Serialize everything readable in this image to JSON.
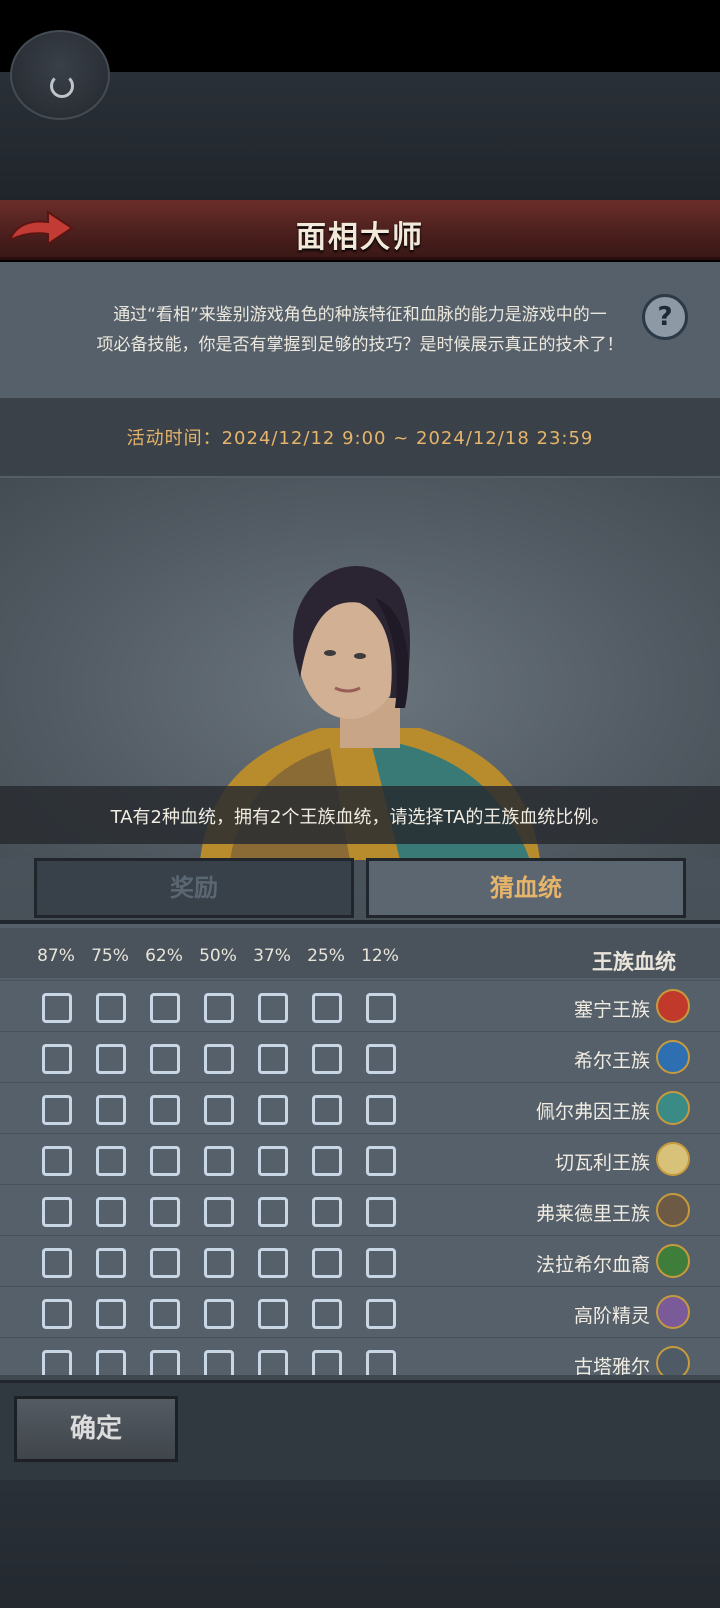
{
  "header": {
    "title": "面相大师"
  },
  "intro": {
    "line1": "通过“看相”来鉴别游戏角色的种族特征和血脉的能力是游戏中的一",
    "line2": "项必备技能，你是否有掌握到足够的技巧？是时候展示真正的技术了！"
  },
  "event": {
    "time_text": "活动时间：2024/12/12 9:00 ~ 2024/12/18 23:59"
  },
  "question": {
    "text": "TA有2种血统，拥有2个王族血统，请选择TA的王族血统比例。"
  },
  "tabs": [
    {
      "label": "猜血统",
      "active": true
    },
    {
      "label": "奖励",
      "active": false
    }
  ],
  "grid": {
    "column_title": "王族血统",
    "percentages": [
      "12%",
      "25%",
      "37%",
      "50%",
      "62%",
      "75%",
      "87%"
    ],
    "rows": [
      {
        "name": "塞宁王族",
        "emblem_color": "#c0392b"
      },
      {
        "name": "希尔王族",
        "emblem_color": "#2d6fb0"
      },
      {
        "name": "佩尔弗因王族",
        "emblem_color": "#3a8a86"
      },
      {
        "name": "切瓦利王族",
        "emblem_color": "#d8c27a"
      },
      {
        "name": "弗莱德里王族",
        "emblem_color": "#6d5a44"
      },
      {
        "name": "法拉希尔血裔",
        "emblem_color": "#3f7d3a"
      },
      {
        "name": "高阶精灵",
        "emblem_color": "#7b5a9a"
      },
      {
        "name": "古塔雅尔",
        "emblem_color": "#4e5b66"
      }
    ]
  },
  "footer": {
    "confirm_label": "确定"
  },
  "colors": {
    "accent": "#e6b46a",
    "title_bar": "#6b2e2a",
    "checkbox_border": "#c9d6e6"
  }
}
